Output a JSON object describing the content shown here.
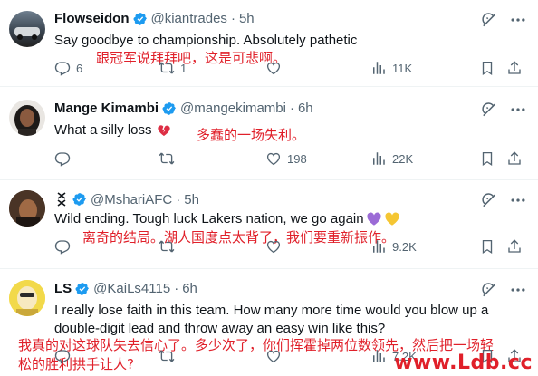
{
  "tweets": [
    {
      "name": "Flowseidon",
      "handle": "@kiantrades",
      "time": "5h",
      "text": "Say goodbye to championship. Absolutely pathetic",
      "translation": "跟冠军说拜拜吧，这是可悲啊。",
      "replies": "6",
      "reposts": "1",
      "likes": "",
      "views": "11K"
    },
    {
      "name": "Mange Kimambi",
      "handle": "@mangekimambi",
      "time": "6h",
      "text": "What a silly loss",
      "translation": "多蠢的一场失利。",
      "replies": "",
      "reposts": "",
      "likes": "198",
      "views": "22K"
    },
    {
      "name": "",
      "handle": "@MshariAFC",
      "time": "5h",
      "text": "Wild ending. Tough luck Lakers nation, we go again",
      "translation": "离奇的结局。湖人国度点太背了，我们要重新振作。",
      "replies": "",
      "reposts": "",
      "likes": "",
      "views": "9.2K"
    },
    {
      "name": "LS",
      "handle": "@KaiLs4115",
      "time": "6h",
      "text_line1": "I really lose faith in this team. How many more time would you blow up a",
      "text_line2": "double-digit lead and throw away an easy win like this?",
      "translation_line1": "我真的对这球队失去信心了。多少次了，你们挥霍掉两位数领先，然后把一场轻",
      "translation_line2": "松的胜利拱手让人?",
      "replies": "",
      "reposts": "",
      "likes": "",
      "views": "7.2K"
    }
  ],
  "separator": "·",
  "watermark": "www.Ldb.cc",
  "colors": {
    "verified": "#1d9bf0",
    "translation": "#e0202a",
    "muted": "#536471"
  },
  "icons": [
    "grok-icon",
    "more-icon",
    "reply-icon",
    "repost-icon",
    "like-icon",
    "views-icon",
    "bookmark-icon",
    "share-icon",
    "verified-badge-icon"
  ]
}
